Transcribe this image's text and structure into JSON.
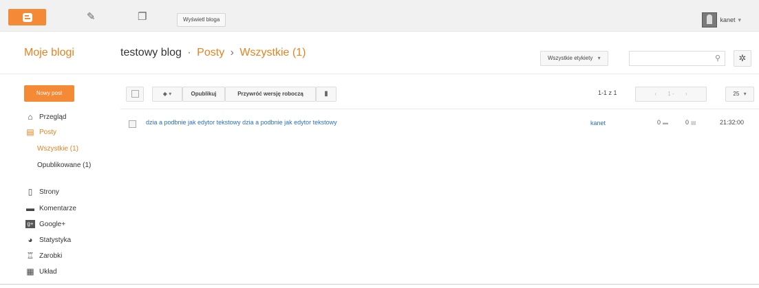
{
  "topbar": {
    "view_blog_label": "Wyświetl bloga",
    "user_name": "kanet",
    "user_caret": "▾",
    "icons": [
      "blogger-logo-icon",
      "pencil-icon",
      "pages-icon"
    ]
  },
  "header": {
    "my_blogs": "Moje blogi",
    "blog_name": "testowy blog",
    "dot": "·",
    "posts": "Posty",
    "arrow": "›",
    "all": "Wszystkie (1)",
    "labels_button": "Wszystkie etykiety",
    "labels_caret": "▾"
  },
  "sidebar": {
    "new_post": "Nowy post",
    "items": [
      {
        "label": "Przegląd",
        "icon": "home-icon"
      },
      {
        "label": "Posty",
        "icon": "posts-icon"
      },
      {
        "label": "Wszystkie (1)"
      },
      {
        "label": "Opublikowane (1)"
      },
      {
        "label": "Strony",
        "icon": "page-icon"
      },
      {
        "label": "Komentarze",
        "icon": "comment-icon"
      },
      {
        "label": "Google+",
        "icon": "googleplus-icon"
      },
      {
        "label": "Statystyka",
        "icon": "stats-icon"
      },
      {
        "label": "Zarobki",
        "icon": "trophy-icon"
      },
      {
        "label": "Układ",
        "icon": "layout-icon"
      }
    ]
  },
  "toolbar": {
    "publish": "Opublikuj",
    "revert": "Przywróć wersję roboczą",
    "page_count": "1-1 z 1",
    "page_prev": "‹",
    "page_range": "1 -",
    "page_next": "›",
    "per_page": "25",
    "caret": "▾"
  },
  "posts": [
    {
      "title": "dzia a podbnie jak edytor tekstowy dzia a podbnie jak edytor tekstowy",
      "author": "kanet",
      "comments": "0",
      "views": "0",
      "time": "21:32:00"
    }
  ],
  "colors": {
    "accent": "#f48a36",
    "link": "#2a6fc2"
  }
}
